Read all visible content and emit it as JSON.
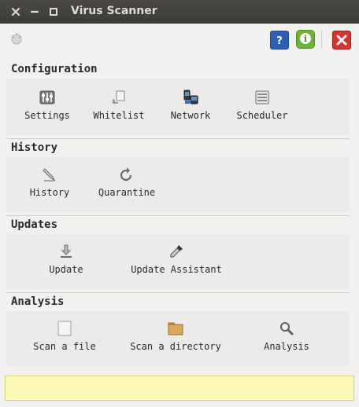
{
  "window": {
    "title": "Virus Scanner",
    "controls": {
      "close": "×",
      "minimize": "–",
      "maximize": "□"
    }
  },
  "toolbar": {
    "help_tooltip": "Help",
    "info_tooltip": "About",
    "quit_tooltip": "Quit"
  },
  "sections": {
    "configuration": {
      "title": "Configuration",
      "items": {
        "settings": "Settings",
        "whitelist": "Whitelist",
        "network": "Network",
        "scheduler": "Scheduler"
      }
    },
    "history": {
      "title": "History",
      "items": {
        "history": "History",
        "quarantine": "Quarantine"
      }
    },
    "updates": {
      "title": "Updates",
      "items": {
        "update": "Update",
        "update_assistant": "Update Assistant"
      }
    },
    "analysis": {
      "title": "Analysis",
      "items": {
        "scan_file": "Scan a file",
        "scan_directory": "Scan a directory",
        "analysis": "Analysis"
      }
    }
  },
  "statusbar": {
    "text": ""
  }
}
